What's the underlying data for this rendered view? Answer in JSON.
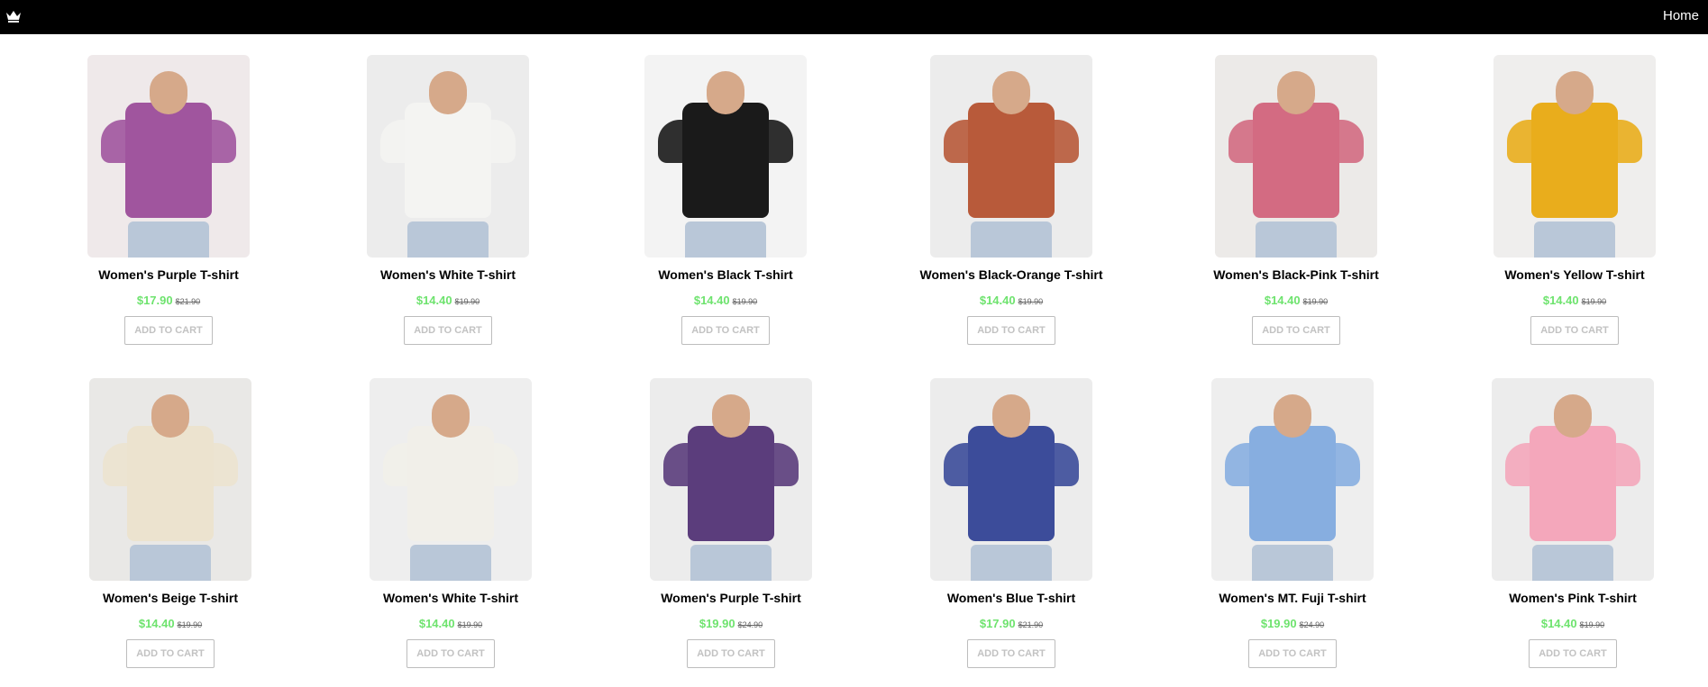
{
  "header": {
    "logo_icon": "crown-icon",
    "nav_home": "Home"
  },
  "products": [
    {
      "name": "Women's Purple T-shirt",
      "price": "$17.90",
      "old_price": "$21.90",
      "button": "ADD TO CART",
      "color": "#a0559e",
      "bg": "#efe9ea"
    },
    {
      "name": "Women's White T-shirt",
      "price": "$14.40",
      "old_price": "$19.90",
      "button": "ADD TO CART",
      "color": "#f4f4f2",
      "bg": "#ececec"
    },
    {
      "name": "Women's Black T-shirt",
      "price": "$14.40",
      "old_price": "$19.90",
      "button": "ADD TO CART",
      "color": "#1a1a1a",
      "bg": "#f3f3f3"
    },
    {
      "name": "Women's Black-Orange T-shirt",
      "price": "$14.40",
      "old_price": "$19.90",
      "button": "ADD TO CART",
      "color": "#b85a3a",
      "bg": "#ececec"
    },
    {
      "name": "Women's Black-Pink T-shirt",
      "price": "$14.40",
      "old_price": "$19.90",
      "button": "ADD TO CART",
      "color": "#d36b82",
      "bg": "#eceae8"
    },
    {
      "name": "Women's Yellow T-shirt",
      "price": "$14.40",
      "old_price": "$19.90",
      "button": "ADD TO CART",
      "color": "#e9ad1c",
      "bg": "#efeeed"
    },
    {
      "name": "Women's Beige T-shirt",
      "price": "$14.40",
      "old_price": "$19.90",
      "button": "ADD TO CART",
      "color": "#ece3cf",
      "bg": "#e9e8e6"
    },
    {
      "name": "Women's White T-shirt",
      "price": "$14.40",
      "old_price": "$19.90",
      "button": "ADD TO CART",
      "color": "#f1efe9",
      "bg": "#eeeeee"
    },
    {
      "name": "Women's Purple T-shirt",
      "price": "$19.90",
      "old_price": "$24.90",
      "button": "ADD TO CART",
      "color": "#5b3d7c",
      "bg": "#ececec"
    },
    {
      "name": "Women's Blue T-shirt",
      "price": "$17.90",
      "old_price": "$21.90",
      "button": "ADD TO CART",
      "color": "#3c4c9a",
      "bg": "#ececec"
    },
    {
      "name": "Women's MT. Fuji T-shirt",
      "price": "$19.90",
      "old_price": "$24.90",
      "button": "ADD TO CART",
      "color": "#87aee0",
      "bg": "#eeeeee"
    },
    {
      "name": "Women's Pink T-shirt",
      "price": "$14.40",
      "old_price": "$19.90",
      "button": "ADD TO CART",
      "color": "#f4a7bb",
      "bg": "#ececec"
    }
  ]
}
